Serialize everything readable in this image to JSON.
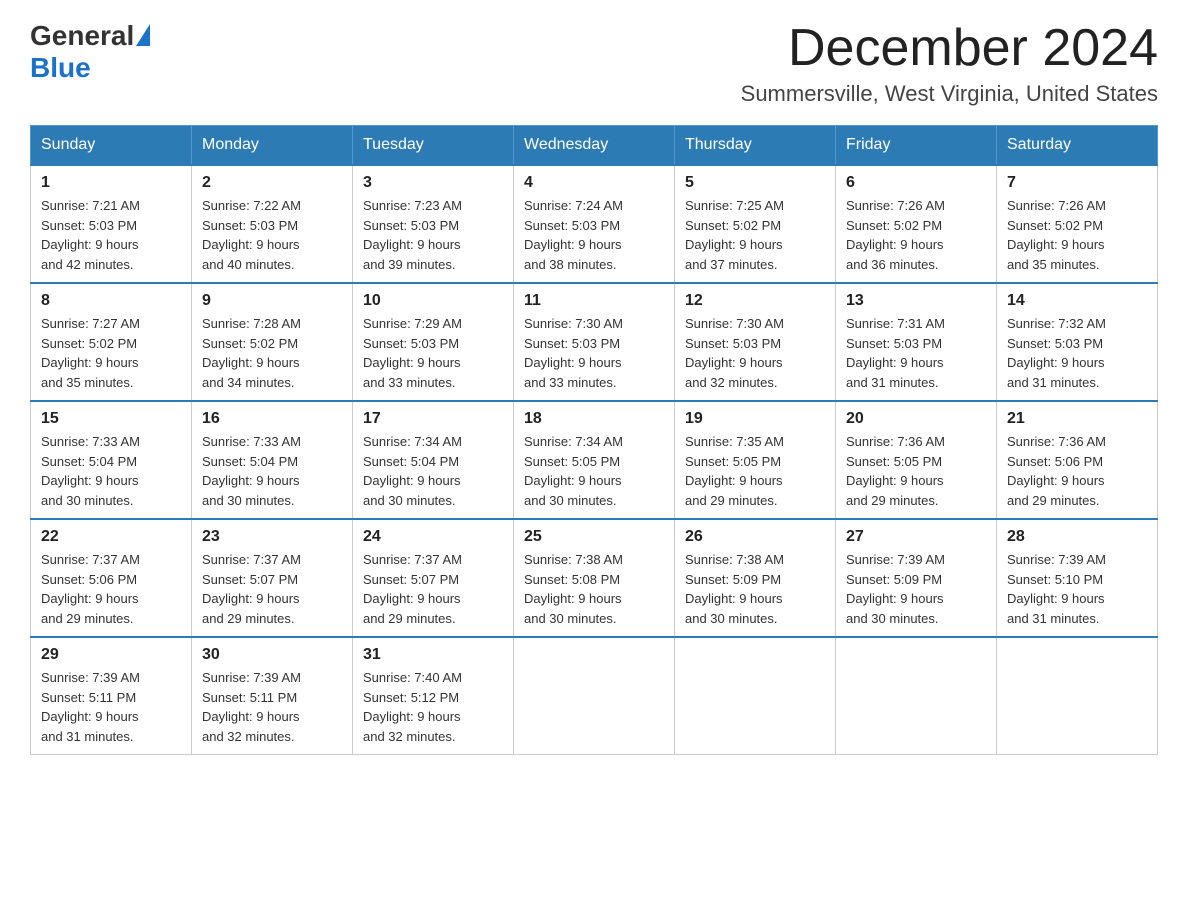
{
  "header": {
    "logo": {
      "general": "General",
      "blue": "Blue"
    },
    "title": "December 2024",
    "location": "Summersville, West Virginia, United States"
  },
  "days_of_week": [
    "Sunday",
    "Monday",
    "Tuesday",
    "Wednesday",
    "Thursday",
    "Friday",
    "Saturday"
  ],
  "weeks": [
    [
      {
        "day": "1",
        "sunrise": "7:21 AM",
        "sunset": "5:03 PM",
        "daylight": "9 hours and 42 minutes."
      },
      {
        "day": "2",
        "sunrise": "7:22 AM",
        "sunset": "5:03 PM",
        "daylight": "9 hours and 40 minutes."
      },
      {
        "day": "3",
        "sunrise": "7:23 AM",
        "sunset": "5:03 PM",
        "daylight": "9 hours and 39 minutes."
      },
      {
        "day": "4",
        "sunrise": "7:24 AM",
        "sunset": "5:03 PM",
        "daylight": "9 hours and 38 minutes."
      },
      {
        "day": "5",
        "sunrise": "7:25 AM",
        "sunset": "5:02 PM",
        "daylight": "9 hours and 37 minutes."
      },
      {
        "day": "6",
        "sunrise": "7:26 AM",
        "sunset": "5:02 PM",
        "daylight": "9 hours and 36 minutes."
      },
      {
        "day": "7",
        "sunrise": "7:26 AM",
        "sunset": "5:02 PM",
        "daylight": "9 hours and 35 minutes."
      }
    ],
    [
      {
        "day": "8",
        "sunrise": "7:27 AM",
        "sunset": "5:02 PM",
        "daylight": "9 hours and 35 minutes."
      },
      {
        "day": "9",
        "sunrise": "7:28 AM",
        "sunset": "5:02 PM",
        "daylight": "9 hours and 34 minutes."
      },
      {
        "day": "10",
        "sunrise": "7:29 AM",
        "sunset": "5:03 PM",
        "daylight": "9 hours and 33 minutes."
      },
      {
        "day": "11",
        "sunrise": "7:30 AM",
        "sunset": "5:03 PM",
        "daylight": "9 hours and 33 minutes."
      },
      {
        "day": "12",
        "sunrise": "7:30 AM",
        "sunset": "5:03 PM",
        "daylight": "9 hours and 32 minutes."
      },
      {
        "day": "13",
        "sunrise": "7:31 AM",
        "sunset": "5:03 PM",
        "daylight": "9 hours and 31 minutes."
      },
      {
        "day": "14",
        "sunrise": "7:32 AM",
        "sunset": "5:03 PM",
        "daylight": "9 hours and 31 minutes."
      }
    ],
    [
      {
        "day": "15",
        "sunrise": "7:33 AM",
        "sunset": "5:04 PM",
        "daylight": "9 hours and 30 minutes."
      },
      {
        "day": "16",
        "sunrise": "7:33 AM",
        "sunset": "5:04 PM",
        "daylight": "9 hours and 30 minutes."
      },
      {
        "day": "17",
        "sunrise": "7:34 AM",
        "sunset": "5:04 PM",
        "daylight": "9 hours and 30 minutes."
      },
      {
        "day": "18",
        "sunrise": "7:34 AM",
        "sunset": "5:05 PM",
        "daylight": "9 hours and 30 minutes."
      },
      {
        "day": "19",
        "sunrise": "7:35 AM",
        "sunset": "5:05 PM",
        "daylight": "9 hours and 29 minutes."
      },
      {
        "day": "20",
        "sunrise": "7:36 AM",
        "sunset": "5:05 PM",
        "daylight": "9 hours and 29 minutes."
      },
      {
        "day": "21",
        "sunrise": "7:36 AM",
        "sunset": "5:06 PM",
        "daylight": "9 hours and 29 minutes."
      }
    ],
    [
      {
        "day": "22",
        "sunrise": "7:37 AM",
        "sunset": "5:06 PM",
        "daylight": "9 hours and 29 minutes."
      },
      {
        "day": "23",
        "sunrise": "7:37 AM",
        "sunset": "5:07 PM",
        "daylight": "9 hours and 29 minutes."
      },
      {
        "day": "24",
        "sunrise": "7:37 AM",
        "sunset": "5:07 PM",
        "daylight": "9 hours and 29 minutes."
      },
      {
        "day": "25",
        "sunrise": "7:38 AM",
        "sunset": "5:08 PM",
        "daylight": "9 hours and 30 minutes."
      },
      {
        "day": "26",
        "sunrise": "7:38 AM",
        "sunset": "5:09 PM",
        "daylight": "9 hours and 30 minutes."
      },
      {
        "day": "27",
        "sunrise": "7:39 AM",
        "sunset": "5:09 PM",
        "daylight": "9 hours and 30 minutes."
      },
      {
        "day": "28",
        "sunrise": "7:39 AM",
        "sunset": "5:10 PM",
        "daylight": "9 hours and 31 minutes."
      }
    ],
    [
      {
        "day": "29",
        "sunrise": "7:39 AM",
        "sunset": "5:11 PM",
        "daylight": "9 hours and 31 minutes."
      },
      {
        "day": "30",
        "sunrise": "7:39 AM",
        "sunset": "5:11 PM",
        "daylight": "9 hours and 32 minutes."
      },
      {
        "day": "31",
        "sunrise": "7:40 AM",
        "sunset": "5:12 PM",
        "daylight": "9 hours and 32 minutes."
      },
      null,
      null,
      null,
      null
    ]
  ]
}
